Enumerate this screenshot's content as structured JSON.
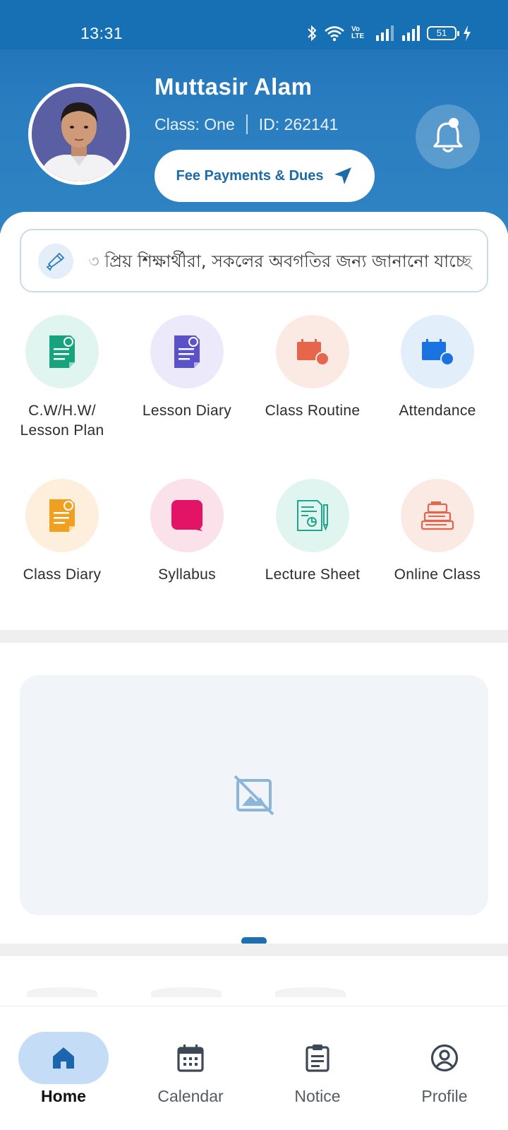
{
  "status_bar": {
    "time": "13:31",
    "battery": "51",
    "network_label": "Vo LTE"
  },
  "profile": {
    "name": "Muttasir Alam",
    "class_text": "Class: One",
    "id_text": "ID: 262141",
    "fee_button_label": "Fee Payments & Dues"
  },
  "notice": {
    "marquee_text": "৩  প্রিয় শিক্ষার্থীরা, সকলের অবগতির জন্য জানানো যাচ্ছে"
  },
  "menu": {
    "items": [
      {
        "label": "C.W/H.W/\nLesson Plan",
        "icon": "document-icon",
        "color": "#16a37e",
        "bg": "#e0f5ef"
      },
      {
        "label": "Lesson Diary",
        "icon": "document-icon",
        "color": "#5b52c9",
        "bg": "#ece9fb"
      },
      {
        "label": "Class Routine",
        "icon": "calendar-clock-icon",
        "color": "#e5664b",
        "bg": "#fbe9e4"
      },
      {
        "label": "Attendance",
        "icon": "calendar-clock-icon",
        "color": "#1a73e0",
        "bg": "#e3eefb"
      },
      {
        "label": "Class Diary",
        "icon": "document-icon",
        "color": "#f0a020",
        "bg": "#fdefdc"
      },
      {
        "label": "Syllabus",
        "icon": "chat-square-icon",
        "color": "#e31466",
        "bg": "#fbe1ea"
      },
      {
        "label": "Lecture Sheet",
        "icon": "lecture-sheet-icon",
        "color": "#21a58c",
        "bg": "#e0f5ef"
      },
      {
        "label": "Online Class",
        "icon": "stacked-books-icon",
        "color": "#e0674e",
        "bg": "#fbe9e4"
      }
    ]
  },
  "nav": {
    "items": [
      {
        "label": "Home",
        "icon": "home-icon",
        "active": true
      },
      {
        "label": "Calendar",
        "icon": "calendar-icon",
        "active": false
      },
      {
        "label": "Notice",
        "icon": "clipboard-icon",
        "active": false
      },
      {
        "label": "Profile",
        "icon": "user-circle-icon",
        "active": false
      }
    ]
  },
  "colors": {
    "header": "#1a6fb3",
    "accent": "#1f6fb0",
    "nav_active_bg": "#c5dcf6",
    "banner_bg": "#f1f5fa"
  }
}
